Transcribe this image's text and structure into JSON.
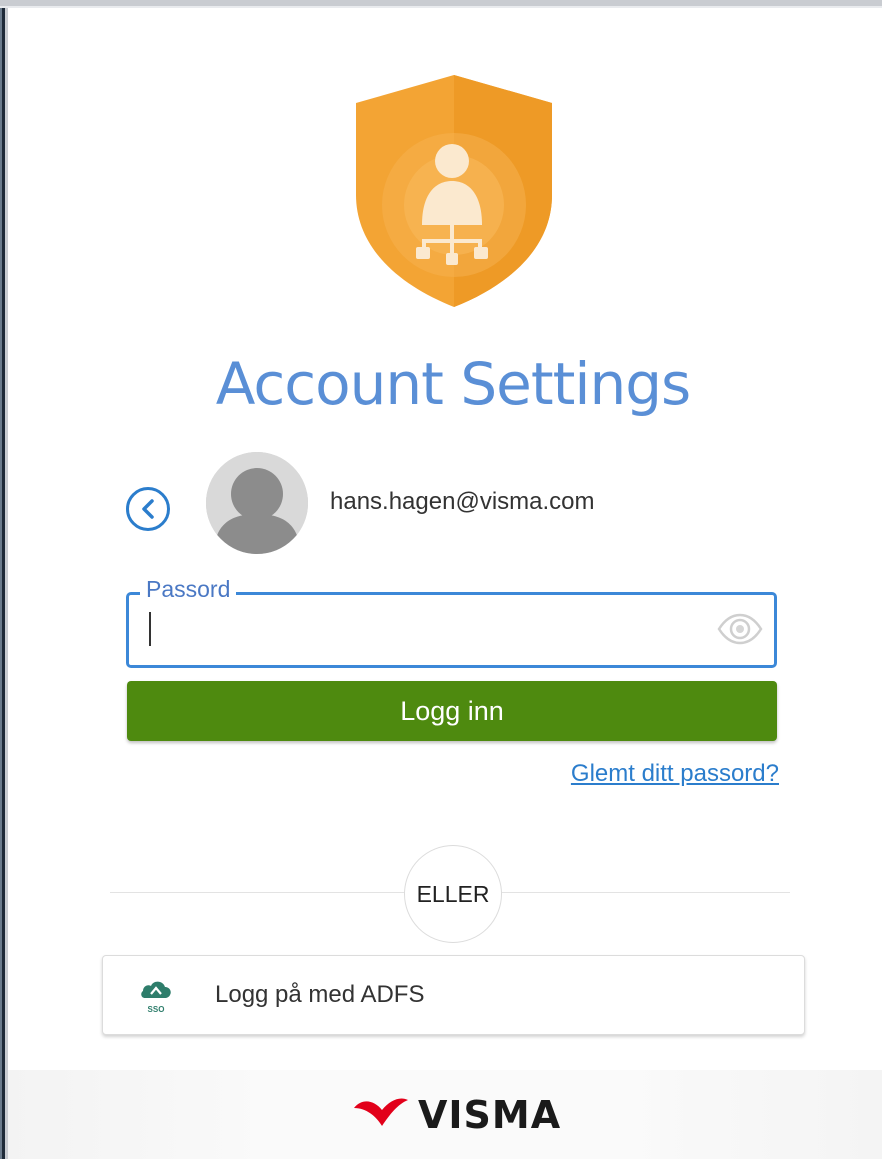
{
  "page": {
    "title": "Account Settings"
  },
  "user": {
    "email": "hans.hagen@visma.com"
  },
  "password": {
    "label": "Passord",
    "value": "",
    "placeholder": ""
  },
  "actions": {
    "login_label": "Logg inn",
    "forgot_label": "Glemt ditt passord?",
    "or_label": "ELLER",
    "adfs_label": "Logg på med ADFS",
    "adfs_icon_text": "SSO"
  },
  "footer": {
    "brand": "VISMA"
  },
  "colors": {
    "accent_blue": "#2b7dcc",
    "title_blue": "#5a8fd6",
    "login_green": "#4e8a0f",
    "shield_orange": "#f0a030",
    "brand_red": "#e2001a"
  },
  "icons": {
    "back": "chevron-left-icon",
    "avatar": "user-avatar-icon",
    "eye": "eye-icon",
    "shield": "shield-user-icon",
    "cloud": "cloud-sso-icon"
  }
}
